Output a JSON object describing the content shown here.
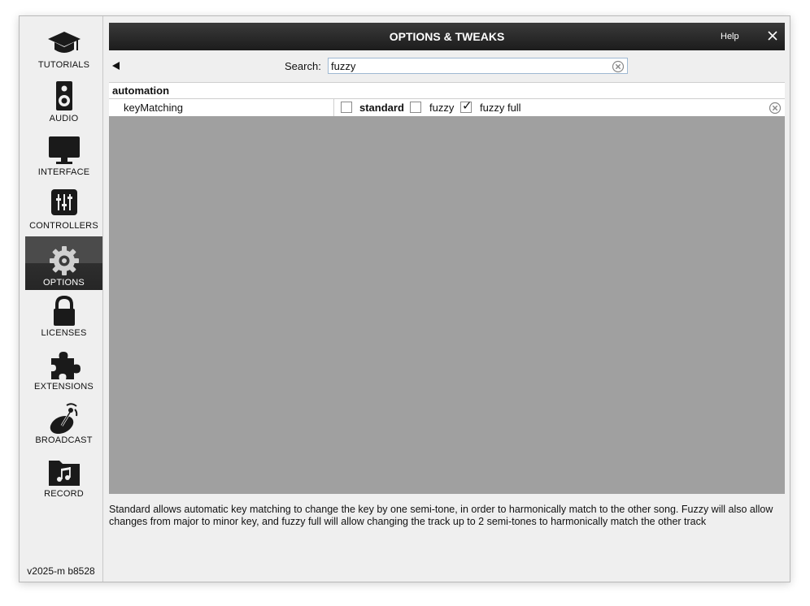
{
  "sidebar": {
    "items": [
      {
        "label": "TUTORIALS",
        "icon": "graduation-cap-icon"
      },
      {
        "label": "AUDIO",
        "icon": "speaker-icon"
      },
      {
        "label": "INTERFACE",
        "icon": "monitor-icon"
      },
      {
        "label": "CONTROLLERS",
        "icon": "sliders-icon"
      },
      {
        "label": "OPTIONS",
        "icon": "gear-icon",
        "active": true
      },
      {
        "label": "LICENSES",
        "icon": "lock-icon"
      },
      {
        "label": "EXTENSIONS",
        "icon": "puzzle-icon"
      },
      {
        "label": "BROADCAST",
        "icon": "broadcast-icon"
      },
      {
        "label": "RECORD",
        "icon": "music-folder-icon"
      }
    ],
    "version": "v2025-m b8528"
  },
  "header": {
    "title": "OPTIONS & TWEAKS",
    "help_label": "Help"
  },
  "search": {
    "label": "Search:",
    "value": "fuzzy"
  },
  "results": {
    "group": "automation",
    "rows": [
      {
        "name": "keyMatching",
        "options": [
          {
            "label": "standard",
            "checked": false,
            "bold": true
          },
          {
            "label": "fuzzy",
            "checked": false,
            "bold": false
          },
          {
            "label": "fuzzy full",
            "checked": true,
            "bold": false
          }
        ]
      }
    ]
  },
  "description": "Standard allows automatic key matching to change the key by one semi-tone, in order to harmonically match to the other song. Fuzzy will also allow changes from major to minor key, and fuzzy full will allow changing the track up to 2 semi-tones to harmonically match the other track",
  "colors": {
    "titlebar": "#1c1c1c",
    "grid_bg": "#a0a0a0",
    "window_bg": "#efefef",
    "active_nav": "#3a3a3a"
  }
}
